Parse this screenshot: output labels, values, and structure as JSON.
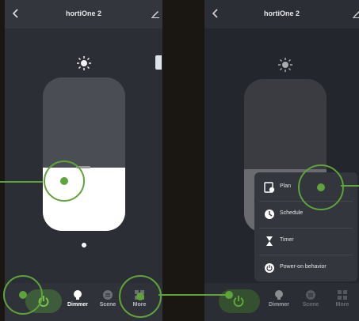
{
  "left_screen": {
    "title": "hortiOne 2",
    "brightness_fraction": 0.41,
    "nav": {
      "dimmer_label": "Dimmer",
      "scene_label": "Scene",
      "more_label": "More"
    }
  },
  "right_screen": {
    "title": "hortiOne 2",
    "brightness_fraction": 0.41,
    "menu": [
      {
        "label": "Plan",
        "icon": "plan-icon"
      },
      {
        "label": "Schedule",
        "icon": "clock-icon"
      },
      {
        "label": "Timer",
        "icon": "hourglass-icon"
      },
      {
        "label": "Power-on behavior",
        "icon": "power-behavior-icon"
      }
    ],
    "nav": {
      "dimmer_label": "Dimmer",
      "scene_label": "Scene",
      "more_label": "More"
    }
  },
  "colors": {
    "highlight": "#5fa33a",
    "panel": "#2b2e35",
    "fill": "#ffffff"
  }
}
